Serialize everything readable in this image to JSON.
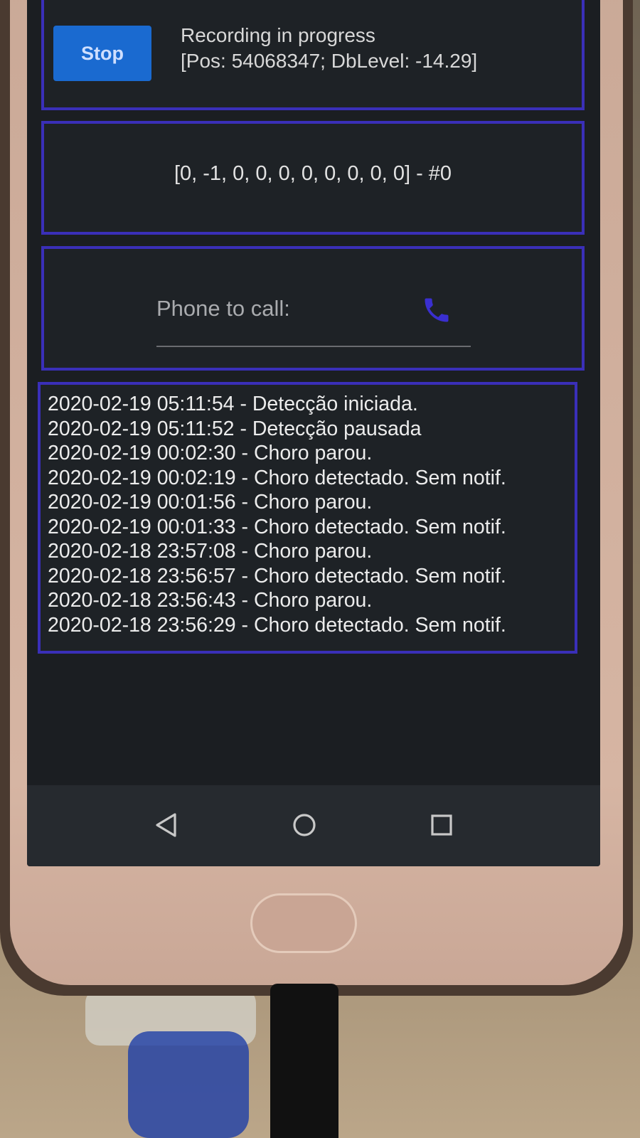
{
  "recording": {
    "stop_label": "Stop",
    "status_line1": "Recording in progress",
    "status_line2": "[Pos: 54068347;  DbLevel: -14.29]"
  },
  "detection": {
    "array_text": "[0, -1, 0, 0, 0, 0, 0, 0, 0, 0] - #0"
  },
  "phone": {
    "placeholder": "Phone to call:",
    "value": "",
    "call_icon": "phone-icon"
  },
  "log": {
    "entries": [
      "2020-02-19 05:11:54 - Detecção iniciada.",
      "2020-02-19 05:11:52 - Detecção pausada",
      "2020-02-19 00:02:30 - Choro parou.",
      "2020-02-19 00:02:19 - Choro detectado. Sem notif.",
      "2020-02-19 00:01:56 - Choro parou.",
      "2020-02-19 00:01:33 - Choro detectado. Sem notif.",
      "2020-02-18 23:57:08 - Choro parou.",
      "2020-02-18 23:56:57 - Choro detectado. Sem notif.",
      "2020-02-18 23:56:43 - Choro parou.",
      "2020-02-18 23:56:29 - Choro detectado. Sem notif."
    ]
  },
  "navbar": {
    "back_icon": "back-triangle-icon",
    "home_icon": "home-circle-icon",
    "recents_icon": "recents-square-icon"
  },
  "colors": {
    "card_border": "#3a2fb8",
    "stop_button": "#1a6ad0",
    "screen_bg": "#1e2226",
    "call_icon": "#3a2fd0"
  }
}
